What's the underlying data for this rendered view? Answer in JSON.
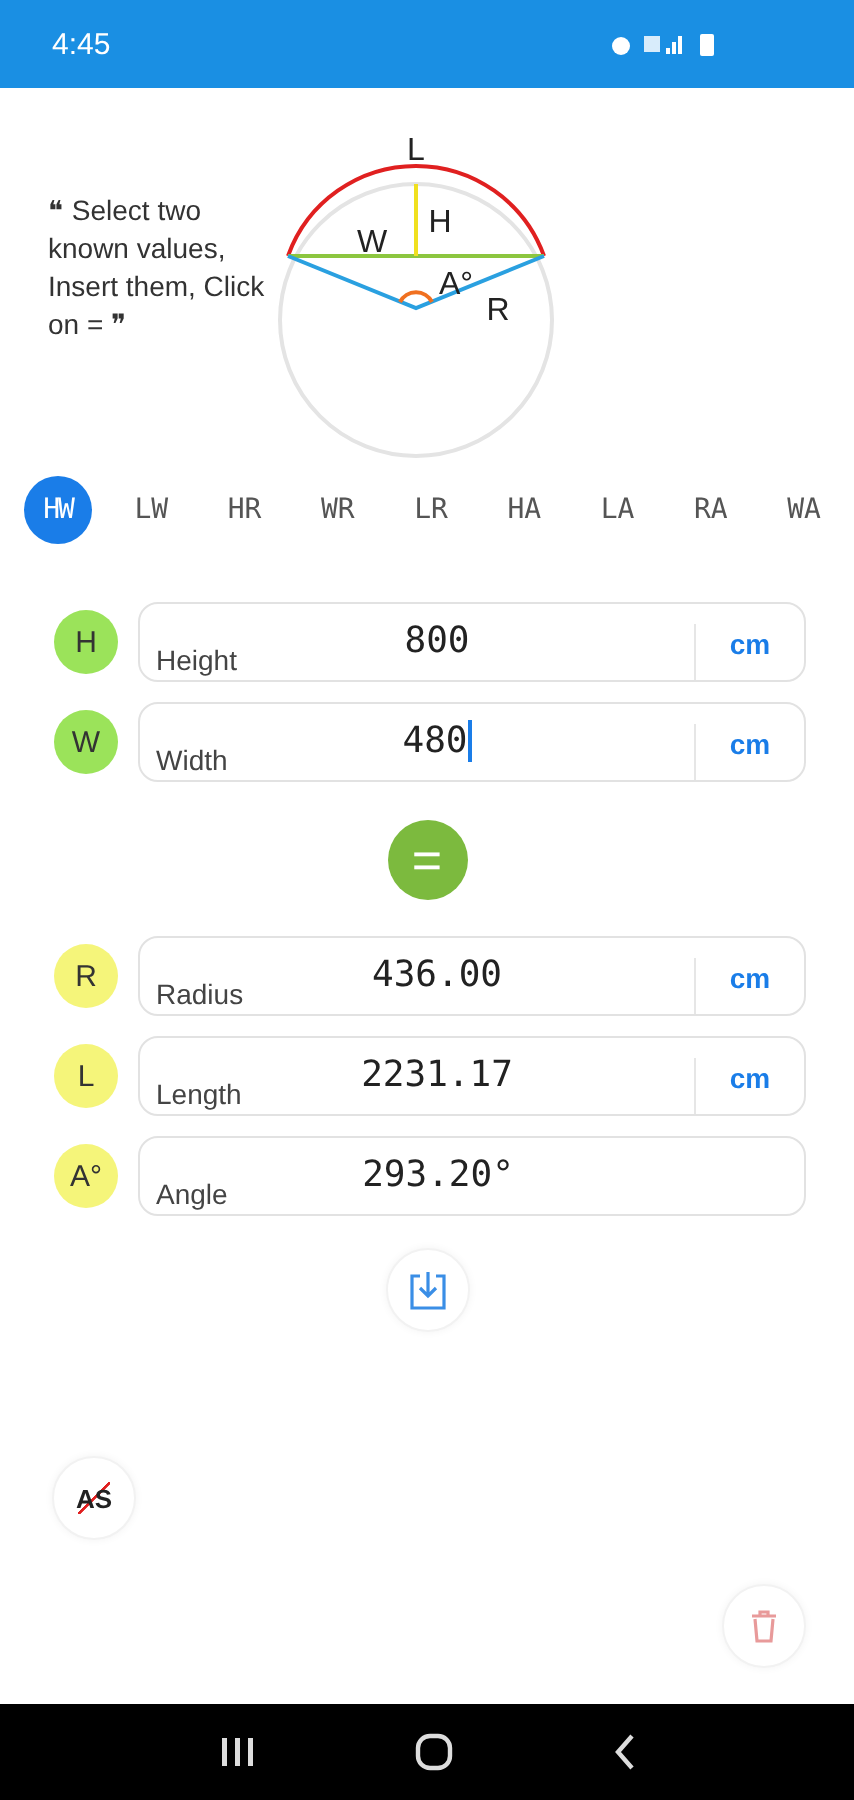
{
  "status_bar": {
    "time": "4:45"
  },
  "diagram": {
    "labels": {
      "length": "L",
      "height": "H",
      "width": "W",
      "angle": "A°",
      "radius": "R"
    }
  },
  "instructions": "❝ Select two known values, Insert them, Click on = ❞",
  "tabs": [
    {
      "label": "HW",
      "selected": true
    },
    {
      "label": "LW",
      "selected": false
    },
    {
      "label": "HR",
      "selected": false
    },
    {
      "label": "WR",
      "selected": false
    },
    {
      "label": "LR",
      "selected": false
    },
    {
      "label": "HA",
      "selected": false
    },
    {
      "label": "LA",
      "selected": false
    },
    {
      "label": "RA",
      "selected": false
    },
    {
      "label": "WA",
      "selected": false
    }
  ],
  "inputs": [
    {
      "badge": "H",
      "color": "#9be35a",
      "label": "Height",
      "value": "800",
      "unit": "cm",
      "focused": false
    },
    {
      "badge": "W",
      "color": "#9be35a",
      "label": "Width",
      "value": "480",
      "unit": "cm",
      "focused": true
    }
  ],
  "equals_button": "=",
  "results": [
    {
      "badge": "R",
      "color": "#f5f57a",
      "label": "Radius",
      "value": "436.00",
      "unit": "cm"
    },
    {
      "badge": "L",
      "color": "#f5f57a",
      "label": "Length",
      "value": "2231.17",
      "unit": "cm"
    },
    {
      "badge": "A°",
      "color": "#f5f57a",
      "label": "Angle",
      "value": "293.20°"
    }
  ],
  "autosave_button": "AS"
}
